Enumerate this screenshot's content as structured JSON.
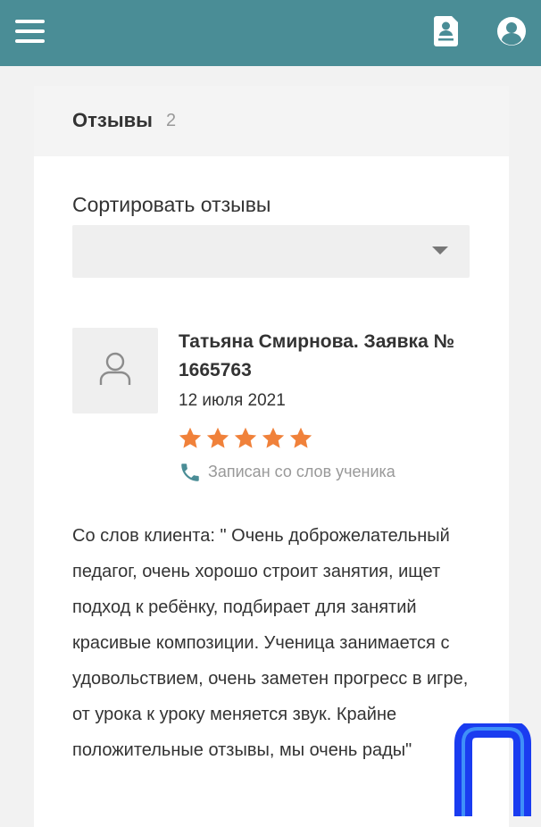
{
  "header": {
    "menu_icon": "hamburger-menu-icon",
    "doc_icon": "document-user-icon",
    "user_icon": "account-circle-icon",
    "color": "#4a8d96"
  },
  "reviews": {
    "title": "Отзывы",
    "count": "2",
    "sort_label": "Сортировать отзывы",
    "sort_value": "",
    "items": [
      {
        "author": "Татьяна Смирнова. Заявка № 1665763",
        "date": "12 июля 2021",
        "rating": 5,
        "source": "Записан со слов ученика",
        "text": "Со слов клиента: \" Очень доброжелательный педагог, очень хорошо строит занятия, ищет подход к ребёнку, подбирает для занятий красивые композиции. Ученица занимается с удовольствием, очень заметен прогресс в игре, от урока к уроку меняется звук. Крайне положительные отзывы, мы очень рады\""
      }
    ]
  },
  "colors": {
    "star": "#f0813a",
    "phone_icon": "#4a8d96",
    "logo": "#1a3cf0"
  }
}
